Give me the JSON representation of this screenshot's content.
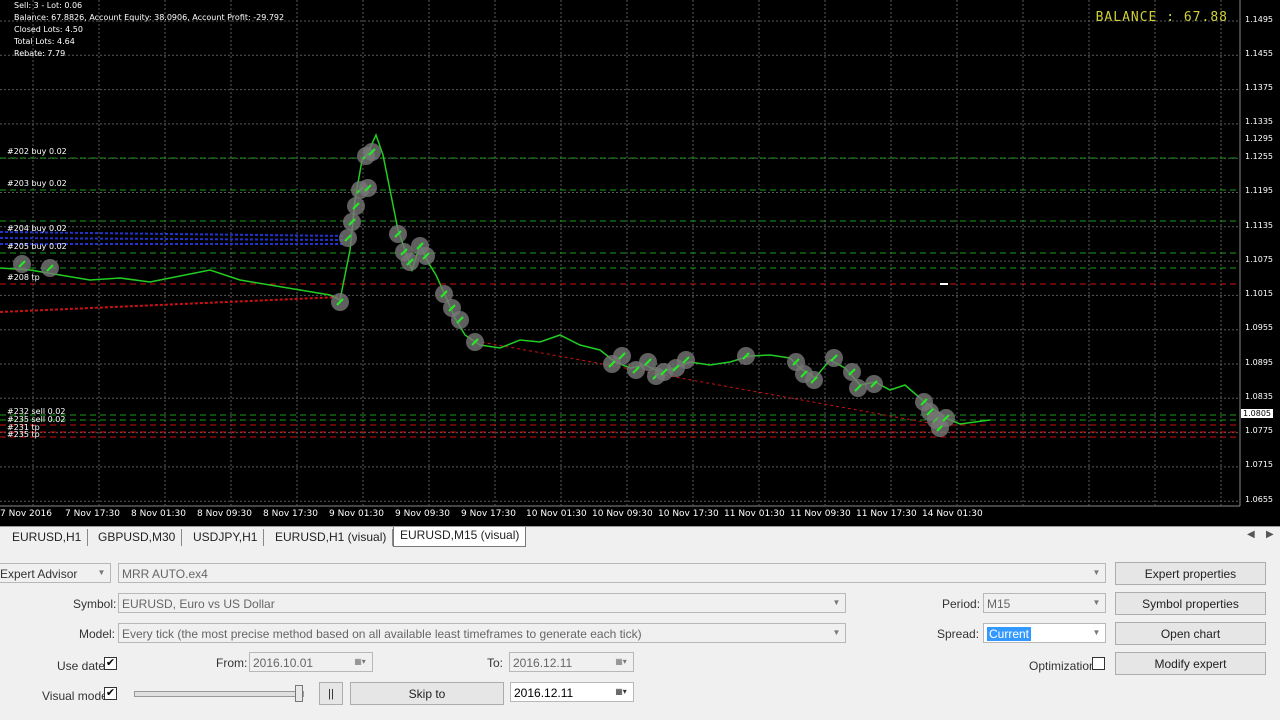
{
  "chart": {
    "info_lines": [
      "Sell: 3 - Lot: 0.06",
      "Balance: 67.8826, Account Equity: 38.0906, Account Profit: -29.792",
      "Closed Lots: 4.50",
      "Total Lots: 4.64",
      "Rebate: 7.79"
    ],
    "balance_text": "BALANCE : 67.88",
    "price_labels": [
      "1.1495",
      "1.1455",
      "1.1375",
      "1.1335",
      "1.1295",
      "1.1255",
      "1.1195",
      "1.1135",
      "1.1075",
      "1.1015",
      "1.0955",
      "1.0895",
      "1.0835",
      "1.0775",
      "1.0715",
      "1.0655"
    ],
    "current_price": "1.0805",
    "time_labels": [
      "7 Nov 2016",
      "7 Nov 17:30",
      "8 Nov 01:30",
      "8 Nov 09:30",
      "8 Nov 17:30",
      "9 Nov 01:30",
      "9 Nov 09:30",
      "9 Nov 17:30",
      "10 Nov 01:30",
      "10 Nov 09:30",
      "10 Nov 17:30",
      "11 Nov 01:30",
      "11 Nov 09:30",
      "11 Nov 17:30",
      "14 Nov 01:30"
    ],
    "order_labels": [
      "#202 buy 0.02",
      "#203 buy 0.02",
      "#204 buy 0.02",
      "#205 buy 0.02",
      "#208 tp",
      "#232 sell 0.02",
      "#235 sell 0.02",
      "#231 tp",
      "#235 tp"
    ],
    "colors": {
      "price_line": "#22cc22",
      "grid": "#5a5a5a",
      "buy_line": "#1a9a1a",
      "tp_line": "#cc1111",
      "blue_line": "#2233cc",
      "balance": "#cfcf3a"
    }
  },
  "tabs": [
    "EURUSD,H1",
    "GBPUSD,M30",
    "USDJPY,H1",
    "EURUSD,H1 (visual)",
    "EURUSD,M15 (visual)"
  ],
  "active_tab": 4,
  "tester": {
    "type_value": "Expert Advisor",
    "expert_value": "MRR AUTO.ex4",
    "symbol_label": "Symbol:",
    "symbol_value": "EURUSD, Euro vs US Dollar",
    "model_label": "Model:",
    "model_value": "Every tick (the most precise method based on all available least timeframes to generate each tick)",
    "use_date_label": "Use date",
    "use_date_checked": "✔",
    "from_label": "From:",
    "from_value": "2016.10.01",
    "to_label": "To:",
    "to_value": "2016.12.11",
    "visual_mode_label": "Visual mode",
    "visual_mode_checked": "✔",
    "pause_label": "||",
    "skip_to_label": "Skip to",
    "skip_to_value": "2016.12.11",
    "period_label": "Period:",
    "period_value": "M15",
    "spread_label": "Spread:",
    "spread_value": "Current",
    "optimization_label": "Optimization",
    "buttons": {
      "expert_properties": "Expert properties",
      "symbol_properties": "Symbol properties",
      "open_chart": "Open chart",
      "modify_expert": "Modify expert"
    }
  }
}
